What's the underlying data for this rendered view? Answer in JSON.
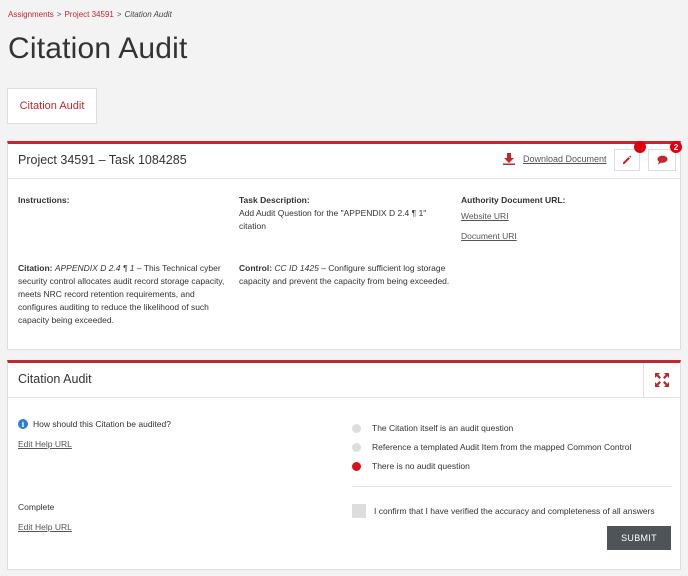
{
  "breadcrumb": {
    "item1": "Assignments",
    "item2": "Project 34591",
    "current": "Citation Audit",
    "separator": ">"
  },
  "page_title": "Citation Audit",
  "tab": {
    "label": "Citation Audit"
  },
  "task_card": {
    "title": "Project 34591 – Task 1084285",
    "download_label": "Download Document",
    "comment_count": "2",
    "instructions_label": "Instructions:",
    "task_description_label": "Task Description:",
    "task_description_text": "Add Audit Question for the \"APPENDIX D 2.4 ¶ 1\" citation",
    "authority_label": "Authority Document URL:",
    "website_uri": "Website URI",
    "document_uri": "Document URI",
    "citation_label": "Citation:",
    "citation_ref": "APPENDIX D 2.4 ¶ 1",
    "citation_text": " – This Technical cyber security control allocates audit record storage capacity, meets NRC record retention requirements, and configures auditing to reduce the likelihood of such capacity being exceeded.",
    "control_label": "Control:",
    "control_ref": "CC ID 1425",
    "control_text": " – Configure sufficient log storage capacity and prevent the capacity from being exceeded."
  },
  "audit_card": {
    "title": "Citation Audit",
    "question": "How should this Citation be audited?",
    "edit_help_url": "Edit Help URL",
    "options": [
      {
        "label": "The Citation itself is an audit question",
        "selected": false
      },
      {
        "label": "Reference a templated Audit Item from the mapped Common Control",
        "selected": false
      },
      {
        "label": "There is no audit question",
        "selected": true
      }
    ],
    "complete_label": "Complete",
    "confirm_text": "I confirm that I have verified the accuracy and completeness of all answers",
    "submit_label": "SUBMIT"
  },
  "colors": {
    "accent": "#c0282e",
    "badge": "#e0000f",
    "info": "#2b7cd3",
    "button": "#4f5458"
  },
  "icons": {
    "download": "download-icon",
    "edit": "pencil-icon",
    "comment": "comment-icon",
    "expand": "expand-arrows-icon",
    "info": "info-icon"
  }
}
